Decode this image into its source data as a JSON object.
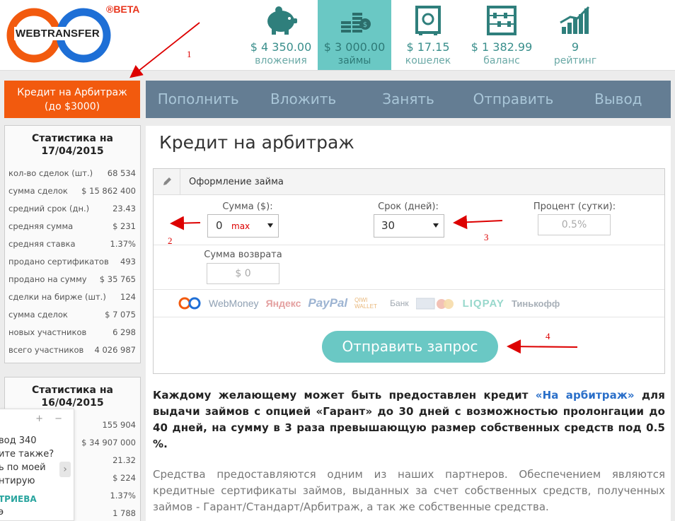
{
  "header": {
    "logo_text": "WEBTRANSFER",
    "beta": "®BETA",
    "stats": [
      {
        "value": "$ 4 350.00",
        "label": "вложения",
        "icon": "piggy-bank-icon",
        "active": false
      },
      {
        "value": "$ 3 000.00",
        "label": "займы",
        "icon": "coins-icon",
        "active": true
      },
      {
        "value": "$ 17.15",
        "label": "кошелек",
        "icon": "safe-icon",
        "active": false
      },
      {
        "value": "$ 1 382.99",
        "label": "баланс",
        "icon": "abacus-icon",
        "active": false
      },
      {
        "value": "9",
        "label": "рейтинг",
        "icon": "growth-chart-icon",
        "active": false
      }
    ]
  },
  "sidebar": {
    "credit_button": {
      "line1": "Кредит на Арбитраж",
      "line2": "(до $3000)"
    },
    "stats1": {
      "title_line1": "Статистика на",
      "title_line2": "17/04/2015",
      "rows": [
        {
          "label": "кол-во сделок (шт.)",
          "value": "68 534"
        },
        {
          "label": "сумма сделок",
          "value": "$ 15 862 400"
        },
        {
          "label": "средний срок (дн.)",
          "value": "23.43"
        },
        {
          "label": "средняя сумма",
          "value": "$ 231"
        },
        {
          "label": "средняя ставка",
          "value": "1.37%"
        },
        {
          "label": "продано сертификатов",
          "value": "493"
        },
        {
          "label": "продано на сумму",
          "value": "$ 35 765"
        },
        {
          "label": "сделки на бирже (шт.)",
          "value": "124"
        },
        {
          "label": "сумма сделок",
          "value": "$ 7 075"
        },
        {
          "label": "новых участников",
          "value": "6 298"
        },
        {
          "label": "всего участников",
          "value": "4 026 987"
        }
      ]
    },
    "stats2": {
      "title_line1": "Статистика на",
      "title_line2": "16/04/2015",
      "rows": [
        {
          "label": "т.)",
          "value": "155 904"
        },
        {
          "label": "",
          "value": "$ 34 907 000"
        },
        {
          "label": ".)",
          "value": "21.32"
        },
        {
          "label": "",
          "value": "$ 224"
        },
        {
          "label": "",
          "value": "1.37%"
        },
        {
          "label": "икатов",
          "value": "1 788"
        }
      ]
    }
  },
  "chat": {
    "controls": "+ −",
    "line1": "вод 340",
    "line2": "ите также?",
    "line3": "ь по моей",
    "line4": "нтирую",
    "name": "ТРИЕВА",
    "line6": "э",
    "arrow": "›"
  },
  "nav": {
    "items": [
      "Пополнить",
      "Вложить",
      "Занять",
      "Отправить",
      "Вывод"
    ]
  },
  "main": {
    "title": "Кредит на арбитраж",
    "form": {
      "header": "Оформление займа",
      "amount_label": "Сумма ($):",
      "amount_value": "0",
      "amount_max": "max",
      "term_label": "Срок (дней):",
      "term_value": "30",
      "percent_label": "Процент (сутки):",
      "percent_value": "0.5%",
      "return_label": "Сумма возврата",
      "return_value": "$ 0",
      "payment_logos": [
        "WebMoney",
        "Яндекс",
        "PayPal",
        "QIWI WALLET",
        "Банк",
        "LIQPAY",
        "Тинькофф"
      ],
      "submit": "Отправить запрос"
    },
    "desc_bold_pre": "Каждому желающему может быть предоставлен кредит ",
    "desc_bold_link": "«На арбитраж»",
    "desc_bold_post": " для выдачи займов с опцией «Гарант» до 30 дней с возможностью пролонгации до 40 дней, на сумму в 3 раза превышающую размер собственных средств под 0.5 %.",
    "desc_normal": "Средства предоставляются одним из наших партнеров. Обеспечением являются кредитные сертификаты займов, выданных за счет собственных средств, полученных займов - Гарант/Стандарт/Арбитраж, а так же собственные средства."
  },
  "annotations": [
    "1",
    "2",
    "3",
    "4"
  ],
  "colors": {
    "accent_orange": "#f25a0e",
    "teal": "#6ac8c4",
    "nav_bg": "#647d93",
    "link_blue": "#2a6fc9",
    "annotation_red": "#dd0000"
  }
}
